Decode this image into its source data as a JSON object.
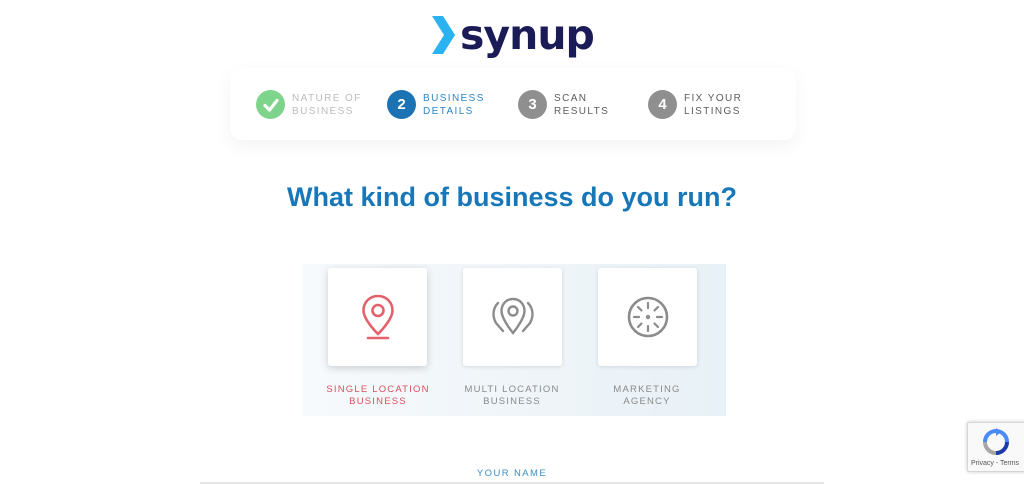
{
  "brand": {
    "name": "synup",
    "text_color": "#1b1c57",
    "chevron_color": "#2ab3f0"
  },
  "stepper": {
    "steps": [
      {
        "number": "",
        "label_line1": "NATURE OF",
        "label_line2": "BUSINESS",
        "state": "done",
        "icon": "check-icon"
      },
      {
        "number": "2",
        "label_line1": "BUSINESS",
        "label_line2": "DETAILS",
        "state": "active"
      },
      {
        "number": "3",
        "label_line1": "SCAN",
        "label_line2": "RESULTS",
        "state": "todo"
      },
      {
        "number": "4",
        "label_line1": "FIX YOUR",
        "label_line2": "LISTINGS",
        "state": "todo"
      }
    ]
  },
  "question": "What kind of business do you run?",
  "options": [
    {
      "label_line1": "SINGLE LOCATION",
      "label_line2": "BUSINESS",
      "icon": "map-pin-icon",
      "selected": true
    },
    {
      "label_line1": "MULTI LOCATION",
      "label_line2": "BUSINESS",
      "icon": "multi-location-pin-icon",
      "selected": false
    },
    {
      "label_line1": "MARKETING",
      "label_line2": "AGENCY",
      "icon": "dial-icon",
      "selected": false
    }
  ],
  "form": {
    "name_label": "YOUR NAME"
  },
  "recaptcha": {
    "terms": "Privacy - Terms"
  },
  "colors": {
    "accent": "#1777b8",
    "selected": "#d9505c",
    "done": "#7fd48b",
    "inactive": "#8f8f8f"
  }
}
